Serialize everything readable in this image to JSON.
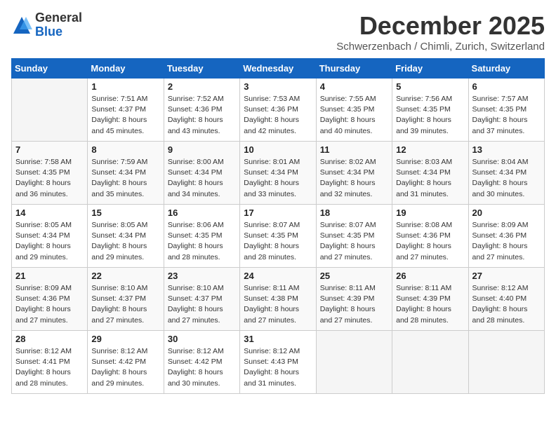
{
  "logo": {
    "general": "General",
    "blue": "Blue"
  },
  "title": "December 2025",
  "location": "Schwerzenbach / Chimli, Zurich, Switzerland",
  "weekdays": [
    "Sunday",
    "Monday",
    "Tuesday",
    "Wednesday",
    "Thursday",
    "Friday",
    "Saturday"
  ],
  "weeks": [
    [
      {
        "day": "",
        "info": ""
      },
      {
        "day": "1",
        "info": "Sunrise: 7:51 AM\nSunset: 4:37 PM\nDaylight: 8 hours\nand 45 minutes."
      },
      {
        "day": "2",
        "info": "Sunrise: 7:52 AM\nSunset: 4:36 PM\nDaylight: 8 hours\nand 43 minutes."
      },
      {
        "day": "3",
        "info": "Sunrise: 7:53 AM\nSunset: 4:36 PM\nDaylight: 8 hours\nand 42 minutes."
      },
      {
        "day": "4",
        "info": "Sunrise: 7:55 AM\nSunset: 4:35 PM\nDaylight: 8 hours\nand 40 minutes."
      },
      {
        "day": "5",
        "info": "Sunrise: 7:56 AM\nSunset: 4:35 PM\nDaylight: 8 hours\nand 39 minutes."
      },
      {
        "day": "6",
        "info": "Sunrise: 7:57 AM\nSunset: 4:35 PM\nDaylight: 8 hours\nand 37 minutes."
      }
    ],
    [
      {
        "day": "7",
        "info": "Sunrise: 7:58 AM\nSunset: 4:35 PM\nDaylight: 8 hours\nand 36 minutes."
      },
      {
        "day": "8",
        "info": "Sunrise: 7:59 AM\nSunset: 4:34 PM\nDaylight: 8 hours\nand 35 minutes."
      },
      {
        "day": "9",
        "info": "Sunrise: 8:00 AM\nSunset: 4:34 PM\nDaylight: 8 hours\nand 34 minutes."
      },
      {
        "day": "10",
        "info": "Sunrise: 8:01 AM\nSunset: 4:34 PM\nDaylight: 8 hours\nand 33 minutes."
      },
      {
        "day": "11",
        "info": "Sunrise: 8:02 AM\nSunset: 4:34 PM\nDaylight: 8 hours\nand 32 minutes."
      },
      {
        "day": "12",
        "info": "Sunrise: 8:03 AM\nSunset: 4:34 PM\nDaylight: 8 hours\nand 31 minutes."
      },
      {
        "day": "13",
        "info": "Sunrise: 8:04 AM\nSunset: 4:34 PM\nDaylight: 8 hours\nand 30 minutes."
      }
    ],
    [
      {
        "day": "14",
        "info": "Sunrise: 8:05 AM\nSunset: 4:34 PM\nDaylight: 8 hours\nand 29 minutes."
      },
      {
        "day": "15",
        "info": "Sunrise: 8:05 AM\nSunset: 4:34 PM\nDaylight: 8 hours\nand 29 minutes."
      },
      {
        "day": "16",
        "info": "Sunrise: 8:06 AM\nSunset: 4:35 PM\nDaylight: 8 hours\nand 28 minutes."
      },
      {
        "day": "17",
        "info": "Sunrise: 8:07 AM\nSunset: 4:35 PM\nDaylight: 8 hours\nand 28 minutes."
      },
      {
        "day": "18",
        "info": "Sunrise: 8:07 AM\nSunset: 4:35 PM\nDaylight: 8 hours\nand 27 minutes."
      },
      {
        "day": "19",
        "info": "Sunrise: 8:08 AM\nSunset: 4:36 PM\nDaylight: 8 hours\nand 27 minutes."
      },
      {
        "day": "20",
        "info": "Sunrise: 8:09 AM\nSunset: 4:36 PM\nDaylight: 8 hours\nand 27 minutes."
      }
    ],
    [
      {
        "day": "21",
        "info": "Sunrise: 8:09 AM\nSunset: 4:36 PM\nDaylight: 8 hours\nand 27 minutes."
      },
      {
        "day": "22",
        "info": "Sunrise: 8:10 AM\nSunset: 4:37 PM\nDaylight: 8 hours\nand 27 minutes."
      },
      {
        "day": "23",
        "info": "Sunrise: 8:10 AM\nSunset: 4:37 PM\nDaylight: 8 hours\nand 27 minutes."
      },
      {
        "day": "24",
        "info": "Sunrise: 8:11 AM\nSunset: 4:38 PM\nDaylight: 8 hours\nand 27 minutes."
      },
      {
        "day": "25",
        "info": "Sunrise: 8:11 AM\nSunset: 4:39 PM\nDaylight: 8 hours\nand 27 minutes."
      },
      {
        "day": "26",
        "info": "Sunrise: 8:11 AM\nSunset: 4:39 PM\nDaylight: 8 hours\nand 28 minutes."
      },
      {
        "day": "27",
        "info": "Sunrise: 8:12 AM\nSunset: 4:40 PM\nDaylight: 8 hours\nand 28 minutes."
      }
    ],
    [
      {
        "day": "28",
        "info": "Sunrise: 8:12 AM\nSunset: 4:41 PM\nDaylight: 8 hours\nand 28 minutes."
      },
      {
        "day": "29",
        "info": "Sunrise: 8:12 AM\nSunset: 4:42 PM\nDaylight: 8 hours\nand 29 minutes."
      },
      {
        "day": "30",
        "info": "Sunrise: 8:12 AM\nSunset: 4:42 PM\nDaylight: 8 hours\nand 30 minutes."
      },
      {
        "day": "31",
        "info": "Sunrise: 8:12 AM\nSunset: 4:43 PM\nDaylight: 8 hours\nand 31 minutes."
      },
      {
        "day": "",
        "info": ""
      },
      {
        "day": "",
        "info": ""
      },
      {
        "day": "",
        "info": ""
      }
    ]
  ]
}
